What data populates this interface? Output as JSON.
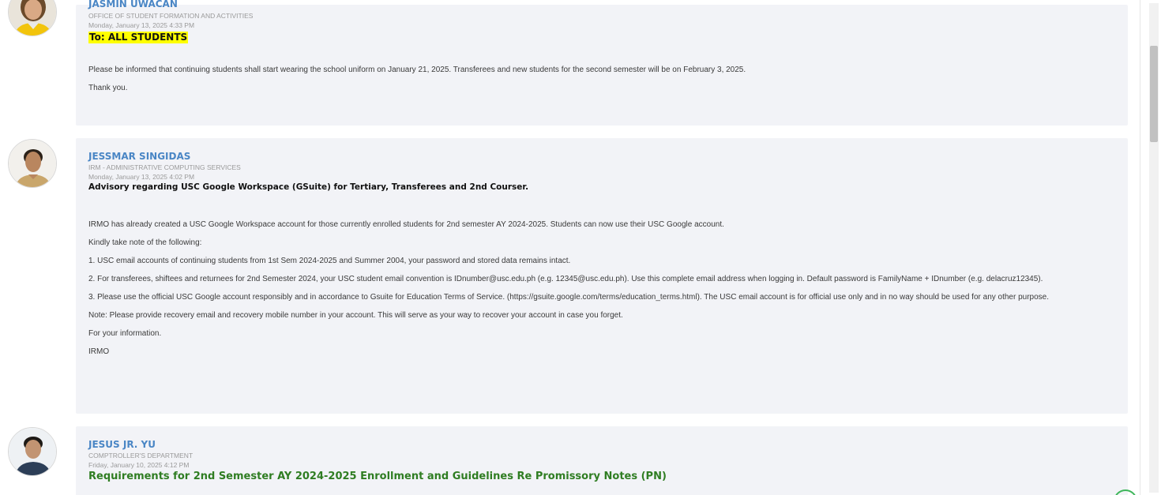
{
  "posts": [
    {
      "author": "JASMIN UWACAN",
      "department": "OFFICE OF STUDENT FORMATION AND ACTIVITIES",
      "date": "Monday, January 13, 2025 4:33 PM",
      "subject": "To: ALL STUDENTS",
      "paragraphs": [
        "Please be informed that continuing students shall start wearing the school uniform on January 21, 2025.  Transferees and new students for the second semester will be on February 3, 2025.",
        "Thank you."
      ]
    },
    {
      "author": "JESSMAR SINGIDAS",
      "department": "IRM - ADMINISTRATIVE COMPUTING SERVICES",
      "date": "Monday, January 13, 2025 4:02 PM",
      "subject": "Advisory regarding USC Google Workspace (GSuite) for Tertiary, Transferees and 2nd Courser.",
      "paragraphs": [
        "IRMO has already created a USC Google Workspace account for those currently enrolled students for 2nd semester AY 2024-2025. Students can now use their USC Google account.",
        "Kindly take note of the following:",
        "1. USC email accounts of continuing students from 1st Sem 2024-2025 and Summer 2004, your password and stored data remains intact.",
        "2. For transferees, shiftees and returnees for 2nd Semester 2024, your USC student email convention is IDnumber@usc.edu.ph (e.g. 12345@usc.edu.ph). Use this complete email address when logging in. Default password is FamilyName + IDnumber (e.g. delacruz12345).",
        "3. Please use the official USC Google account responsibly and in accordance to Gsuite for Education Terms of Service. (https://gsuite.google.com/terms/education_terms.html). The USC email account is for official use only and in no way should be used for any other purpose.",
        "Note: Please provide recovery email and recovery mobile number in your account. This will serve as your way to recover your account in case you forget.",
        "For your information.",
        "IRMO"
      ]
    },
    {
      "author": "JESUS JR. YU",
      "department": "COMPTROLLER'S DEPARTMENT",
      "date": "Friday, January 10, 2025 4:12 PM",
      "subject": "Requirements for 2nd Semester AY 2024-2025 Enrollment and Guidelines Re Promissory Notes (PN)",
      "paragraphs": []
    }
  ]
}
